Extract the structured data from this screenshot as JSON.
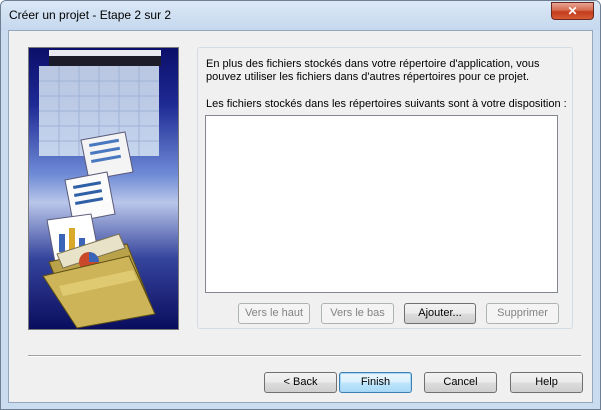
{
  "window": {
    "title": "Créer un projet - Etape 2 sur 2",
    "close_label": "✕"
  },
  "panel": {
    "info_text": "En plus des fichiers stockés dans votre répertoire d'application, vous\npouvez utiliser les fichiers dans d'autres répertoires pour ce projet.",
    "list_label": "Les fichiers stockés dans les répertoires suivants sont à votre disposition :",
    "list_items": [],
    "buttons": {
      "up": "Vers le haut",
      "down": "Vers le bas",
      "add": "Ajouter...",
      "remove": "Supprimer"
    }
  },
  "footer": {
    "back": "< Back",
    "finish": "Finish",
    "cancel": "Cancel",
    "help": "Help"
  },
  "colors": {
    "title_bar": "#c5d8ee",
    "close_button": "#c23d1d",
    "dialog_face": "#f0f0f0",
    "focus_border": "#3c7fb1"
  },
  "icons": {
    "close": "close-icon",
    "illustration": "wizard-folder-charts-illustration"
  }
}
